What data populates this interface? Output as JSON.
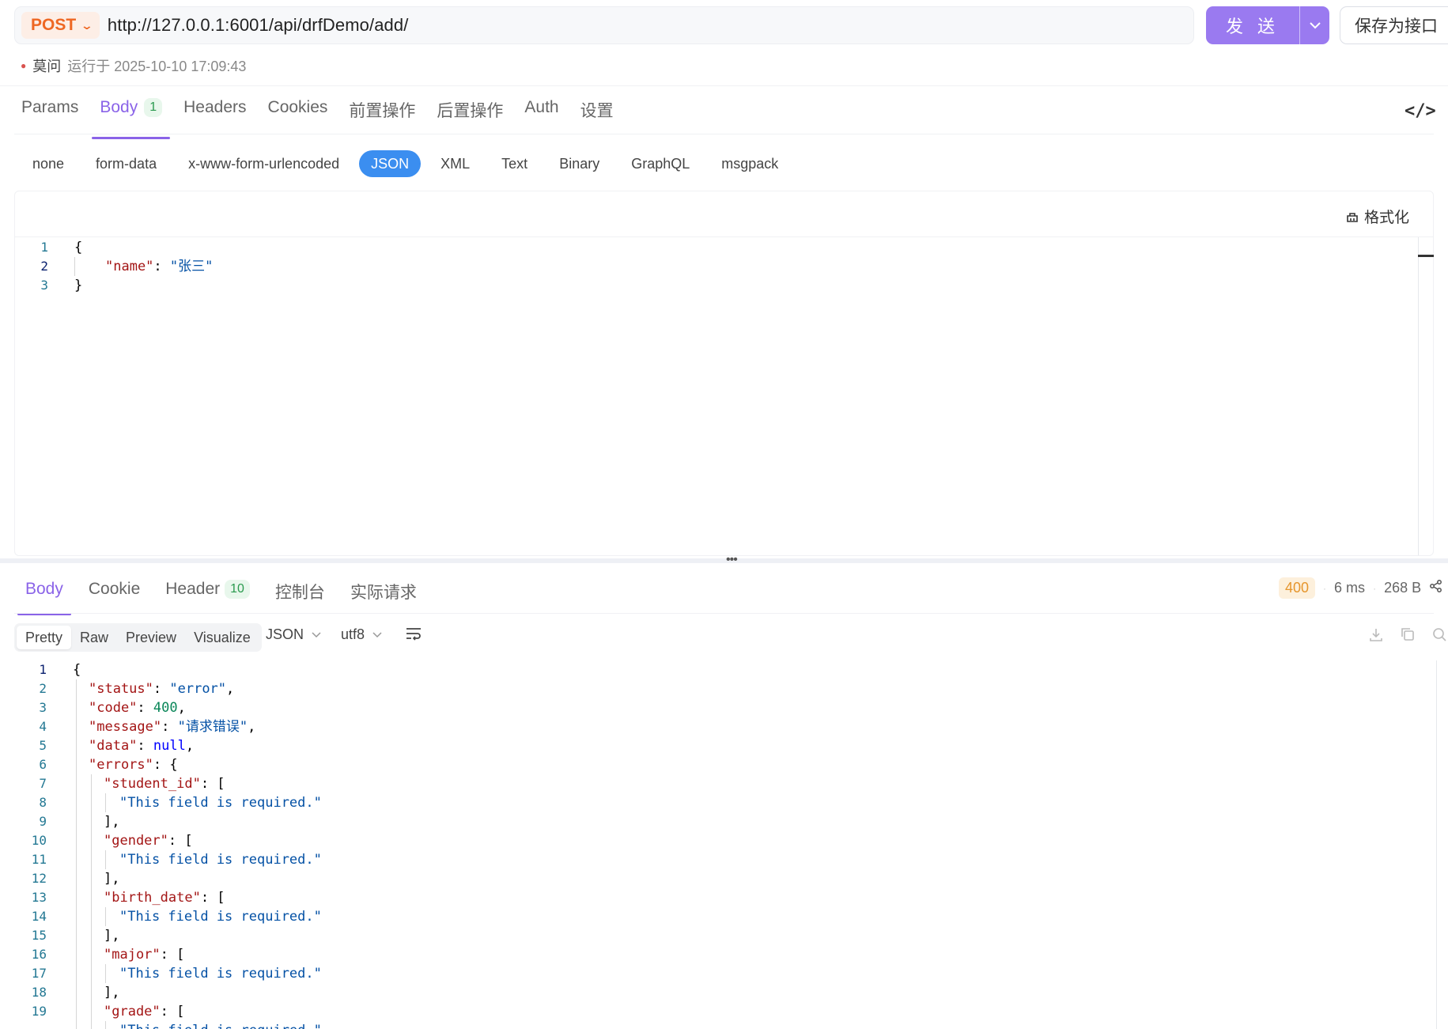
{
  "request": {
    "method": "POST",
    "url": "http://127.0.0.1:6001/api/drfDemo/add/",
    "send_label": "发 送",
    "save_label": "保存为接口",
    "run_user": "莫问",
    "run_text": "运行于 2025-10-10 17:09:43"
  },
  "req_tabs": [
    {
      "label": "Params"
    },
    {
      "label": "Body",
      "badge": "1"
    },
    {
      "label": "Headers"
    },
    {
      "label": "Cookies"
    },
    {
      "label": "前置操作"
    },
    {
      "label": "后置操作"
    },
    {
      "label": "Auth"
    },
    {
      "label": "设置"
    }
  ],
  "body_types": [
    "none",
    "form-data",
    "x-www-form-urlencoded",
    "JSON",
    "XML",
    "Text",
    "Binary",
    "GraphQL",
    "msgpack"
  ],
  "active_body_type": "JSON",
  "format_label": "格式化",
  "request_body_lines": [
    "1",
    "2",
    "3"
  ],
  "request_body": {
    "open": "{",
    "key": "\"name\"",
    "colon": ": ",
    "value": "\"张三\"",
    "close": "}"
  },
  "response": {
    "tabs": [
      {
        "label": "Body"
      },
      {
        "label": "Cookie"
      },
      {
        "label": "Header",
        "badge": "10"
      },
      {
        "label": "控制台"
      },
      {
        "label": "实际请求"
      }
    ],
    "status": "400",
    "time": "6 ms",
    "size": "268 B",
    "view_modes": [
      "Pretty",
      "Raw",
      "Preview",
      "Visualize"
    ],
    "format": "JSON",
    "encoding": "utf8"
  },
  "response_body": {
    "status_key": "\"status\"",
    "status_val": "\"error\"",
    "code_key": "\"code\"",
    "code_val": "400",
    "message_key": "\"message\"",
    "message_val": "\"请求错误\"",
    "data_key": "\"data\"",
    "data_val": "null",
    "errors_key": "\"errors\"",
    "student_id_key": "\"student_id\"",
    "gender_key": "\"gender\"",
    "birth_date_key": "\"birth_date\"",
    "major_key": "\"major\"",
    "grade_key": "\"grade\"",
    "required_msg": "\"This field is required.\""
  },
  "colors": {
    "accent": "#8a63e8",
    "send_button": "#9a7af0",
    "method_post": "#ee6723",
    "json_active": "#3b8ef0",
    "status_400": "#e6962d"
  },
  "icons": {
    "code_toggle": "code-brackets-icon",
    "format": "broom-icon",
    "wrap": "word-wrap-icon",
    "download": "download-icon",
    "copy": "copy-icon",
    "search": "search-icon",
    "share": "share-icon"
  }
}
